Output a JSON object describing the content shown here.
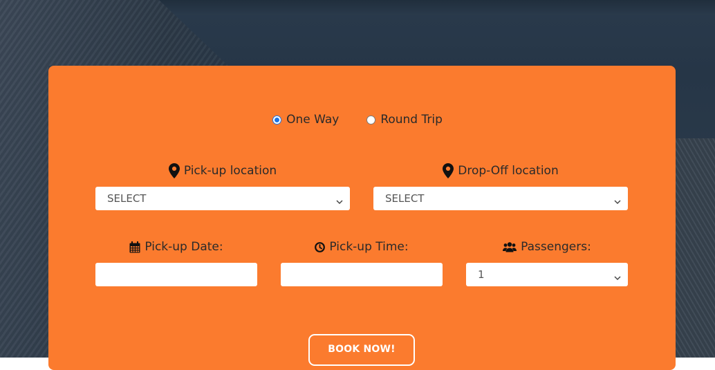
{
  "trip_type": {
    "options": [
      {
        "label": "One Way",
        "checked": true
      },
      {
        "label": "Round Trip",
        "checked": false
      }
    ]
  },
  "pickup_location": {
    "label": "Pick-up location",
    "icon": "map-pin-icon",
    "value": "SELECT"
  },
  "dropoff_location": {
    "label": "Drop-Off location",
    "icon": "map-pin-icon",
    "value": "SELECT"
  },
  "pickup_date": {
    "label": "Pick-up Date:",
    "icon": "calendar-icon",
    "value": ""
  },
  "pickup_time": {
    "label": "Pick-up Time:",
    "icon": "clock-icon",
    "value": ""
  },
  "passengers": {
    "label": "Passengers:",
    "icon": "users-icon",
    "value": "1"
  },
  "book_button": {
    "label": "BOOK NOW!"
  },
  "colors": {
    "card": "#fb7b2e",
    "radio_checked": "#1a73e8",
    "text": "#2a2a2a"
  }
}
